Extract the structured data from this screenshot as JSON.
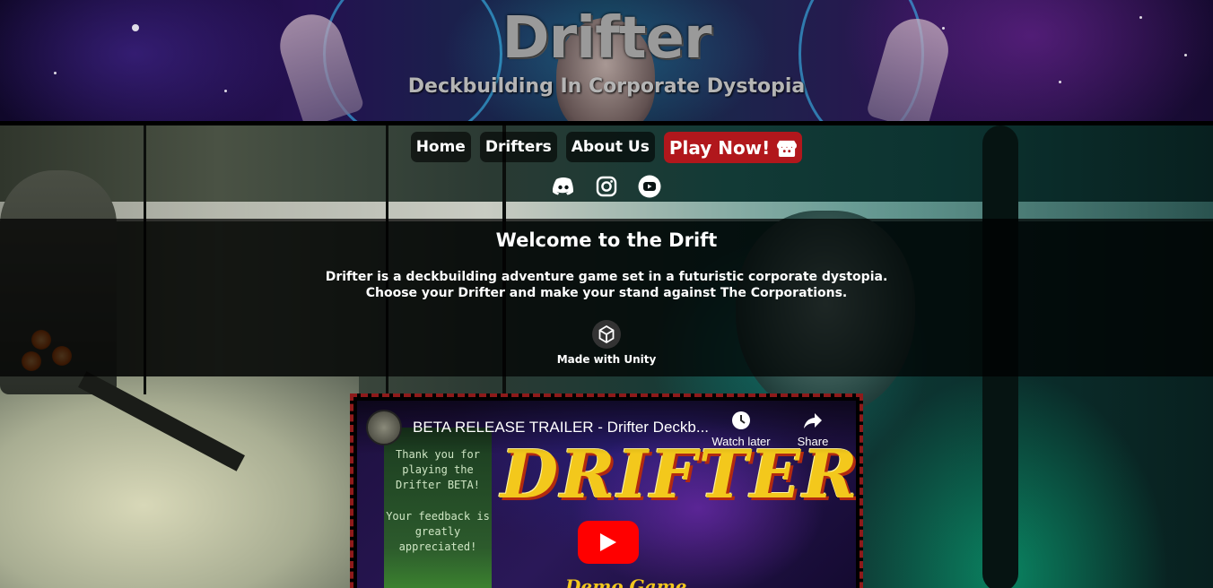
{
  "header": {
    "title": "Drifter",
    "subtitle": "Deckbuilding In Corporate Dystopia"
  },
  "nav": {
    "items": [
      {
        "label": "Home"
      },
      {
        "label": "Drifters"
      },
      {
        "label": "About Us"
      }
    ],
    "play": {
      "label": "Play Now!",
      "icon": "itch-io-icon"
    }
  },
  "socials": [
    {
      "name": "discord-icon"
    },
    {
      "name": "instagram-icon"
    },
    {
      "name": "youtube-icon"
    }
  ],
  "welcome": {
    "title": "Welcome to the Drift",
    "line1": "Drifter is a deckbuilding adventure game set in a futuristic corporate dystopia.",
    "line2": "Choose your Drifter and make your stand against The Corporations.",
    "unity_label": "Made with Unity"
  },
  "video": {
    "title": "BETA RELEASE TRAILER - Drifter Deckb...",
    "watch_later": "Watch later",
    "share": "Share",
    "thumbnail": {
      "side_text_1": "Thank you for playing the Drifter BETA!",
      "side_text_2": "Your feedback is greatly appreciated!",
      "logo": "DRIFTER",
      "subtitle": "Demo Game"
    }
  },
  "colors": {
    "play_button": "#b1171c",
    "video_border": "#8e1a1a",
    "youtube_red": "#ff0000"
  }
}
